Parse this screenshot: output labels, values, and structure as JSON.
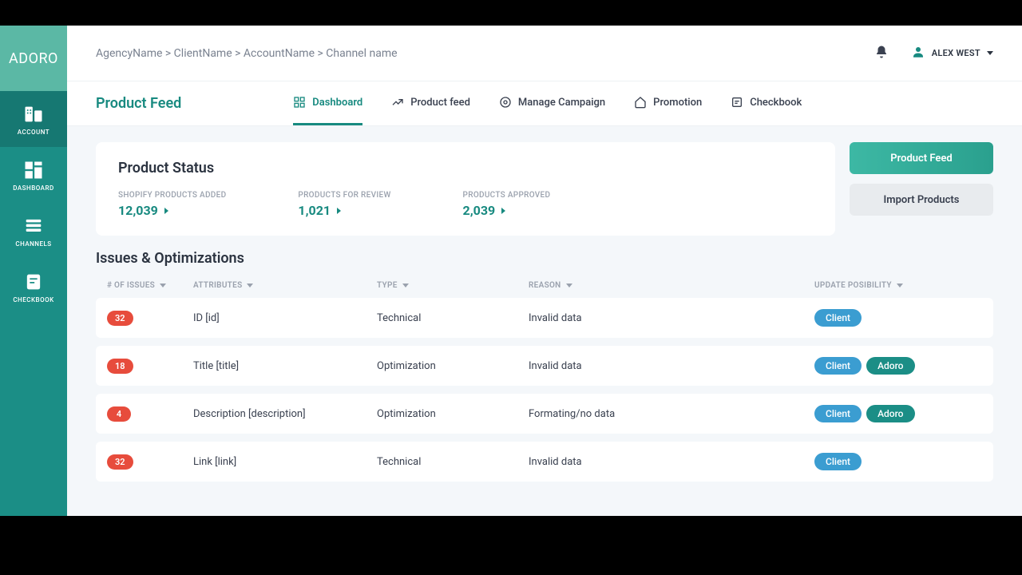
{
  "logo": "ADORO",
  "sidebar": {
    "items": [
      {
        "label": "ACCOUNT",
        "icon": "building"
      },
      {
        "label": "DASHBOARD",
        "icon": "grid"
      },
      {
        "label": "CHANNELS",
        "icon": "layers"
      },
      {
        "label": "CHECKBOOK",
        "icon": "book"
      }
    ]
  },
  "breadcrumb": "AgencyName > ClientName > AccountName > Channel name",
  "user_name": "ALEX WEST",
  "page_title": "Product Feed",
  "tabs": [
    {
      "label": "Dashboard"
    },
    {
      "label": "Product feed"
    },
    {
      "label": "Manage Campaign"
    },
    {
      "label": "Promotion"
    },
    {
      "label": "Checkbook"
    }
  ],
  "status": {
    "title": "Product Status",
    "stats": [
      {
        "label": "SHOPIFY PRODUCTS ADDED",
        "value": "12,039"
      },
      {
        "label": "PRODUCTS FOR REVIEW",
        "value": "1,021"
      },
      {
        "label": "PRODUCTS APPROVED",
        "value": "2,039"
      }
    ]
  },
  "actions": {
    "primary": "Product Feed",
    "secondary": "Import Products"
  },
  "issues": {
    "title": "Issues & Optimizations",
    "columns": {
      "issues": "# OF ISSUES",
      "attributes": "ATTRIBUTES",
      "type": "TYPE",
      "reason": "REASON",
      "update": "UPDATE POSIBILITY"
    },
    "rows": [
      {
        "count": "32",
        "attr": "ID [id]",
        "type": "Technical",
        "reason": "Invalid data",
        "pills": [
          "Client"
        ]
      },
      {
        "count": "18",
        "attr": "Title [title]",
        "type": "Optimization",
        "reason": "Invalid data",
        "pills": [
          "Client",
          "Adoro"
        ]
      },
      {
        "count": "4",
        "attr": "Description [description]",
        "type": "Optimization",
        "reason": "Formating/no data",
        "pills": [
          "Client",
          "Adoro"
        ]
      },
      {
        "count": "32",
        "attr": "Link [link]",
        "type": "Technical",
        "reason": "Invalid data",
        "pills": [
          "Client"
        ]
      }
    ]
  }
}
